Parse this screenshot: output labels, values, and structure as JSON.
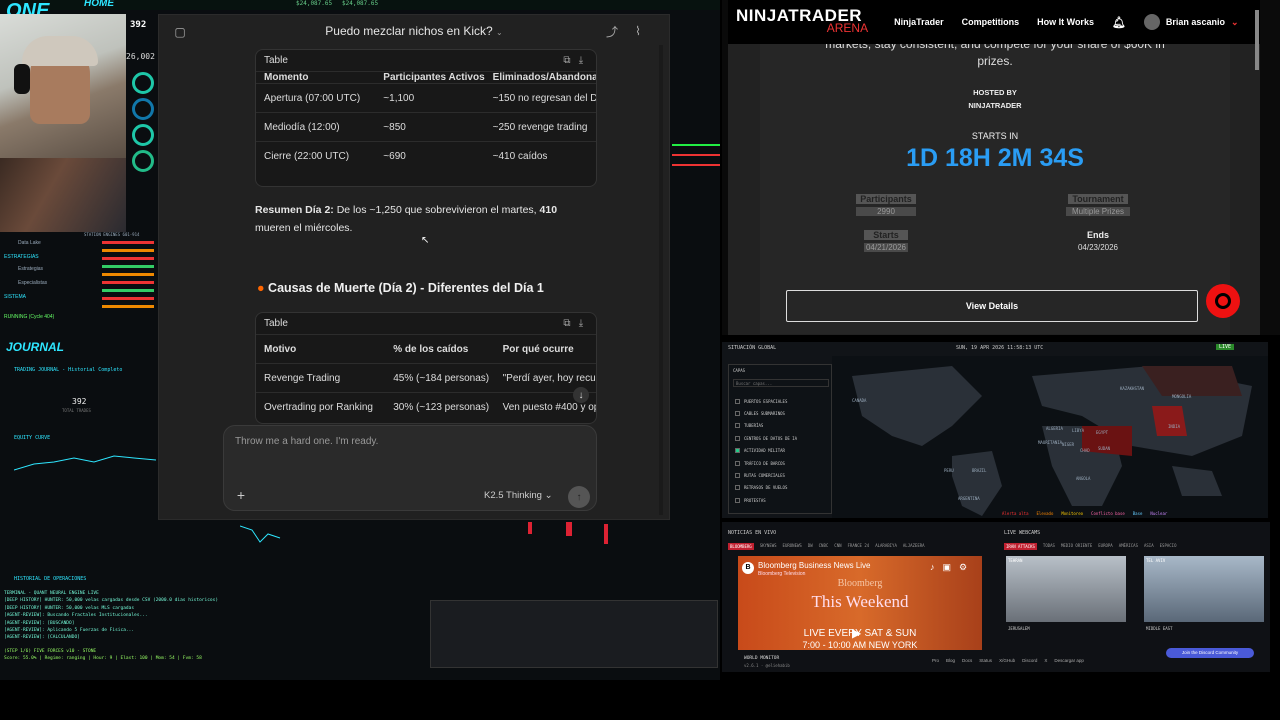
{
  "dashboard": {
    "logo": "ONE",
    "home": "HOME",
    "traders": "392",
    "val1": "$24,087.65",
    "val2": "$24,087.65",
    "val3": "26,002",
    "journal": "JOURNAL",
    "journal_sub": "TRADING JOURNAL - Historial Completo",
    "journal_count": "392",
    "journal_count_label": "TOTAL TRADES",
    "equity": "EQUITY CURVE",
    "historial": "HISTORIAL DE OPERACIONES",
    "sidebar": [
      "Data Lake",
      "ESTRATEGIAS",
      "Estrategias",
      "Especialistas",
      "SISTEMA",
      "RUNNING (Cycle 404)"
    ],
    "terminal": [
      "TERMINAL - QUANT NEURAL ENGINE LIVE",
      "[DEEP HISTORY] HUNTER: 50,000 velas cargadas desde CSV (2000.0 dias historicos)",
      "[DEEP HISTORY] HUNTER: 50,000 velas MLS cargadas",
      "[AGENT-REVIEW]: Buscando Fractales Institucionales...",
      "[AGENT-REVIEW]: [BUSCANDO]",
      "[AGENT-REVIEW]: Aplicando 5 Fuerzas de Fisica...",
      "[AGENT-REVIEW]: [CALCULANDO]",
      "(STEP 1/6) FIVE FORCES v10 - STONE",
      "Score: 55.0% | Regime: ranging | Hour: 9 | Elast: 100 | Mom: 54 | Fvm: 58"
    ],
    "engines_title": "STATION ENGINES 601-914"
  },
  "chat": {
    "title": "Puedo mezclar nichos en Kick?",
    "table1": {
      "label": "Table",
      "headers": [
        "Momento",
        "Participantes Activos",
        "Eliminados/Abandonados"
      ],
      "rows": [
        [
          "Apertura (07:00 UTC)",
          "~1,100",
          "~150 no regresan del Día 1"
        ],
        [
          "Mediodía (12:00)",
          "~850",
          "~250 revenge trading"
        ],
        [
          "Cierre (22:00 UTC)",
          "~690",
          "~410 caídos"
        ]
      ]
    },
    "summary_bold": "Resumen Día 2:",
    "summary_text": " De los ~1,250 que sobrevivieron el martes, ",
    "summary_bold2": "410",
    "summary_text2": " mueren el miércoles.",
    "section_title": "Causas de Muerte (Día 2) - Diferentes del Día 1",
    "table2": {
      "label": "Table",
      "headers": [
        "Motivo",
        "% de los caídos",
        "Por qué ocurre"
      ],
      "rows": [
        [
          "Revenge Trading",
          "45% (~184 personas)",
          "\"Perdí ayer, hoy recupero\""
        ],
        [
          "Overtrading por Ranking",
          "30% (~123 personas)",
          "Ven puesto #400 y operan"
        ]
      ]
    },
    "input_placeholder": "Throw me a hard one. I'm ready.",
    "model": "K2.5 Thinking"
  },
  "ninjatrader": {
    "brand": "NINJATRADER",
    "brand_sub": "ARENA",
    "nav": [
      "NinjaTrader",
      "Competitions",
      "How It Works"
    ],
    "user": "Brian ascanio",
    "intro_line1": "markets, stay consistent, and compete for your share of $60K in",
    "intro_line2": "prizes.",
    "hosted_label": "HOSTED BY",
    "hosted_name": "NINJATRADER",
    "starts_in": "STARTS IN",
    "countdown": "1D 18H 2M 34S",
    "participants_label": "Participants",
    "participants": "2990",
    "tournament_label": "Tournament",
    "tournament": "Multiple Prizes",
    "starts_label": "Starts",
    "starts": "04/21/2026",
    "ends_label": "Ends",
    "ends": "04/23/2026",
    "view_details": "View Details"
  },
  "situation": {
    "title": "SITUACIÓN GLOBAL",
    "datetime": "SUN, 19 APR 2026 11:58:13 UTC",
    "live": "LIVE",
    "layers_title": "CAPAS",
    "search": "Buscar capas...",
    "layers": [
      "PUERTOS ESPACIALES",
      "CABLES SUBMARINOS",
      "TUBERÍAS",
      "CENTROS DE DATOS DE IA",
      "ACTIVIDAD MILITAR",
      "TRÁFICO DE BARCOS",
      "RUTAS COMERCIALES",
      "RETRASOS DE VUELOS",
      "PROTESTAS"
    ],
    "layer_checked": [
      false,
      false,
      false,
      false,
      true,
      false,
      false,
      false,
      false
    ],
    "countries": [
      "CANADA",
      "KAZAKHSTAN",
      "MONGOLIA",
      "ALGERIA",
      "LIBYA",
      "EGYPT",
      "NIGER",
      "SUDAN",
      "CHAD",
      "INDIA",
      "BRAZIL",
      "PERU",
      "ARGENTINA",
      "ANGOLA",
      "MAURITANIA"
    ],
    "legend": [
      "Alerta alta",
      "Elevado",
      "Monitoreo",
      "Conflicto base",
      "Base",
      "Nuclear"
    ]
  },
  "news": {
    "title": "NOTICIAS EN VIVO",
    "tabs": [
      "BLOOMBERG",
      "SKYNEWS",
      "EURONEWS",
      "DW",
      "CNBC",
      "CNN",
      "FRANCE 24",
      "ALARABIYA",
      "ALJAZEERA"
    ],
    "video_title": "Bloomberg Business News Live",
    "video_sub": "Bloomberg Television",
    "bloomberg": "Bloomberg",
    "weekend": "This Weekend",
    "live_line": "LIVE EVERY SAT & SUN",
    "time_line": "7:00 - 10:00 AM NEW YORK",
    "webcams_title": "LIVE WEBCAMS",
    "webcam_tabs": [
      "IRAN ATTACKS",
      "TODAS",
      "MEDIO ORIENTE",
      "EUROPA",
      "AMÉRICAS",
      "ASIA",
      "ESPACIO"
    ],
    "cams": [
      "TEHRAN",
      "TEL AVIV",
      "JERUSALEM",
      "MIDDLE EAST"
    ],
    "footer_brand": "WORLD MONITOR",
    "footer_ver": "v2.6.1 · @eliehabib",
    "footer_links": [
      "Pro",
      "Blog",
      "Docs",
      "Status",
      "X/GHub",
      "Discord",
      "X",
      "Descargar app"
    ],
    "discord": "Join the Discord Community"
  }
}
